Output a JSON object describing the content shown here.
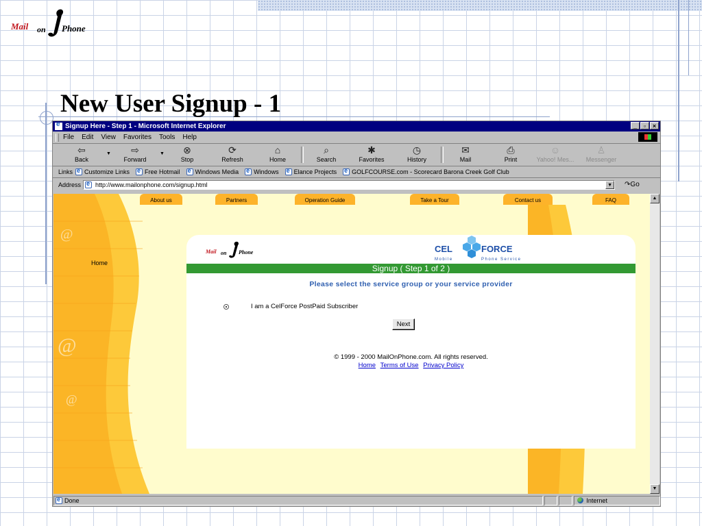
{
  "slide": {
    "title": "New User Signup - 1",
    "logo_word1": "Mail",
    "logo_word2": "on",
    "logo_word3": "Phone"
  },
  "browser": {
    "window_title": "Signup Here - Step 1 - Microsoft Internet Explorer",
    "menu": [
      "File",
      "Edit",
      "View",
      "Favorites",
      "Tools",
      "Help"
    ],
    "toolbar": [
      {
        "label": "Back",
        "icon": "back-arrow-icon"
      },
      {
        "label": "Forward",
        "icon": "forward-arrow-icon"
      },
      {
        "label": "Stop",
        "icon": "stop-icon"
      },
      {
        "label": "Refresh",
        "icon": "refresh-icon"
      },
      {
        "label": "Home",
        "icon": "home-icon"
      },
      {
        "label": "Search",
        "icon": "search-icon"
      },
      {
        "label": "Favorites",
        "icon": "favorites-icon"
      },
      {
        "label": "History",
        "icon": "history-icon"
      },
      {
        "label": "Mail",
        "icon": "mail-icon"
      },
      {
        "label": "Print",
        "icon": "print-icon"
      },
      {
        "label": "Yahoo! Mes...",
        "icon": "yahoo-messenger-icon"
      },
      {
        "label": "Messenger",
        "icon": "messenger-icon"
      }
    ],
    "links_label": "Links",
    "links": [
      "Customize Links",
      "Free Hotmail",
      "Windows Media",
      "Windows",
      "Elance Projects",
      "GOLFCOURSE.com - Scorecard Barona Creek Golf Club"
    ],
    "address_label": "Address",
    "address_value": "http://www.mailonphone.com/signup.html",
    "go_label": "Go",
    "status_text": "Done",
    "zone_text": "Internet"
  },
  "page": {
    "tabs": [
      "About us",
      "Partners",
      "Operation Guide",
      "Take a Tour",
      "Contact us",
      "FAQ"
    ],
    "home_link": "Home",
    "at_symbol": "@",
    "logo_word1": "Mail",
    "logo_word2": "on",
    "logo_word3": "Phone",
    "celforce_left": "CEL",
    "celforce_right": "FORCE",
    "celforce_sub_left": "Mobile",
    "celforce_sub_right": "Phone Service",
    "step_banner": "Signup ( Step 1 of 2 )",
    "instruction": "Please select the service group or your service provider",
    "radio_option": "I am a CelForce PostPaid Subscriber",
    "next_button": "Next",
    "copyright": "© 1999 - 2000 MailOnPhone.com. All rights reserved.",
    "footer_links": [
      "Home",
      "Terms of Use",
      "Privacy Policy"
    ]
  },
  "colors": {
    "page_bg": "#fffccd",
    "accent_orange": "#fdb32a",
    "banner_green": "#339933",
    "title_bar": "#000080",
    "instruction_blue": "#3060b0",
    "link_blue": "#0000cc"
  }
}
